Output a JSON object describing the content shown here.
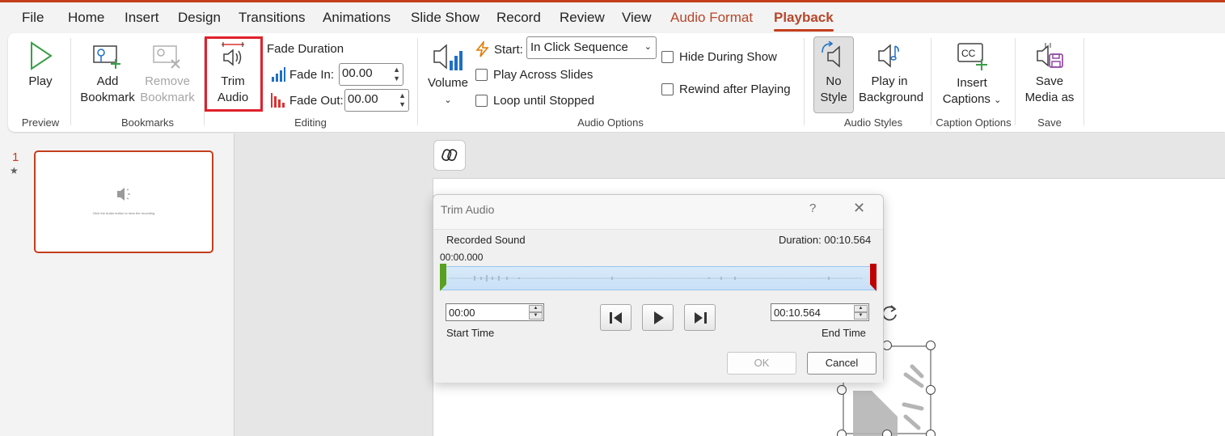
{
  "menu": {
    "tabs": [
      "File",
      "Home",
      "Insert",
      "Design",
      "Transitions",
      "Animations",
      "Slide Show",
      "Record",
      "Review",
      "View",
      "Audio Format",
      "Playback"
    ],
    "active_tab": "Playback",
    "context_tab": "Audio Format"
  },
  "ribbon": {
    "preview": {
      "label": "Preview",
      "play": "Play"
    },
    "bookmarks": {
      "label": "Bookmarks",
      "add_l1": "Add",
      "add_l2": "Bookmark",
      "remove_l1": "Remove",
      "remove_l2": "Bookmark"
    },
    "editing": {
      "label": "Editing",
      "trim_l1": "Trim",
      "trim_l2": "Audio",
      "fade_duration": "Fade Duration",
      "fade_in_label": "Fade In:",
      "fade_in_value": "00.00",
      "fade_out_label": "Fade Out:",
      "fade_out_value": "00.00"
    },
    "audio_options": {
      "label": "Audio Options",
      "volume": "Volume",
      "start_label": "Start:",
      "start_value": "In Click Sequence",
      "play_across": "Play Across Slides",
      "loop": "Loop until Stopped",
      "hide": "Hide During Show",
      "rewind": "Rewind after Playing"
    },
    "audio_styles": {
      "label": "Audio Styles",
      "no_style_l1": "No",
      "no_style_l2": "Style",
      "bg_l1": "Play in",
      "bg_l2": "Background"
    },
    "caption_options": {
      "label": "Caption Options",
      "insert_l1": "Insert",
      "insert_l2": "Captions"
    },
    "save": {
      "label": "Save",
      "save_l1": "Save",
      "save_l2": "Media as"
    }
  },
  "slides": {
    "number": "1",
    "thumb_caption": "Click the Audio button to hear the recording"
  },
  "dialog": {
    "title": "Trim Audio",
    "help": "?",
    "sound_name": "Recorded Sound",
    "duration": "Duration: 00:10.564",
    "position": "00:00.000",
    "start_time_value": "00:00",
    "start_time_label": "Start Time",
    "end_time_value": "00:10.564",
    "end_time_label": "End Time",
    "ok": "OK",
    "cancel": "Cancel"
  },
  "colors": {
    "accent": "#c43e1c",
    "highlight_box": "#e0202a",
    "timeline_fill": "#c8e0f7",
    "start_marker": "#5aa020",
    "end_marker": "#c00000"
  }
}
